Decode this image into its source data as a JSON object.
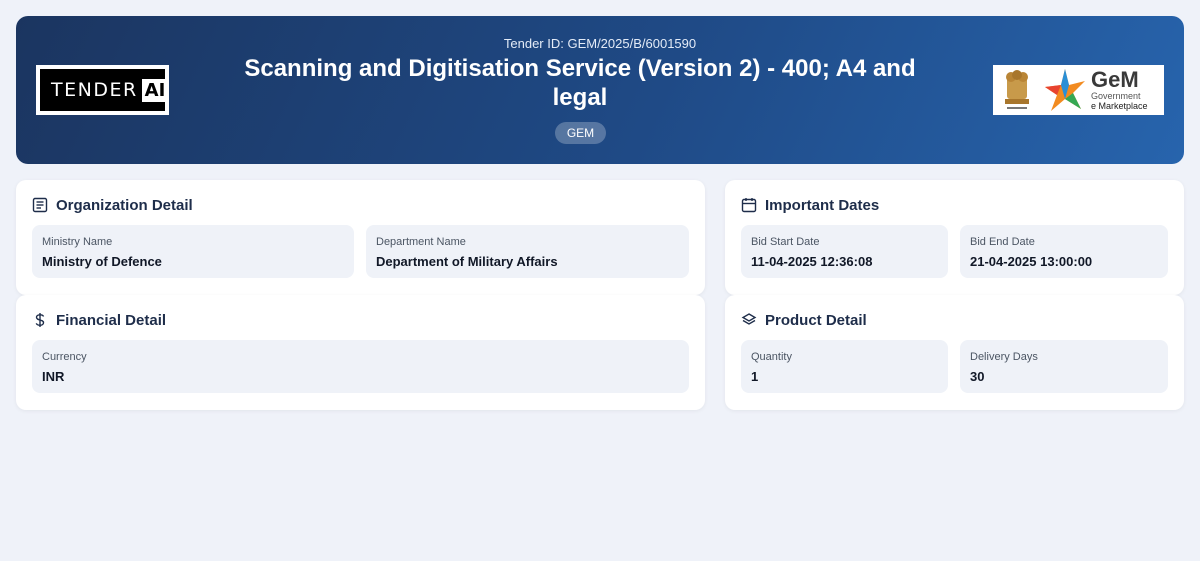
{
  "header": {
    "tender_id": "Tender ID: GEM/2025/B/6001590",
    "title": "Scanning and Digitisation Service (Version 2) - 400; A4 and legal",
    "badge": "GEM",
    "logo_left": {
      "word": "TENDER",
      "ai": "AI"
    },
    "logo_right": {
      "name": "GeM",
      "line1": "Government",
      "line2": "e Marketplace"
    }
  },
  "organization": {
    "title": "Organization Detail",
    "icon": "document-list-icon",
    "fields": [
      {
        "label": "Ministry Name",
        "value": "Ministry of Defence"
      },
      {
        "label": "Department Name",
        "value": "Department of Military Affairs"
      }
    ]
  },
  "dates": {
    "title": "Important Dates",
    "icon": "calendar-icon",
    "fields": [
      {
        "label": "Bid Start Date",
        "value": "11-04-2025 12:36:08"
      },
      {
        "label": "Bid End Date",
        "value": "21-04-2025 13:00:00"
      }
    ]
  },
  "financial": {
    "title": "Financial Detail",
    "icon": "dollar-icon",
    "fields": [
      {
        "label": "Currency",
        "value": "INR"
      }
    ]
  },
  "product": {
    "title": "Product Detail",
    "icon": "layers-icon",
    "fields": [
      {
        "label": "Quantity",
        "value": "1"
      },
      {
        "label": "Delivery Days",
        "value": "30"
      }
    ]
  },
  "colors": {
    "header_start": "#1b3560",
    "header_end": "#2764ad",
    "page_bg": "#eff2f9",
    "field_bg": "#eff2f8"
  }
}
